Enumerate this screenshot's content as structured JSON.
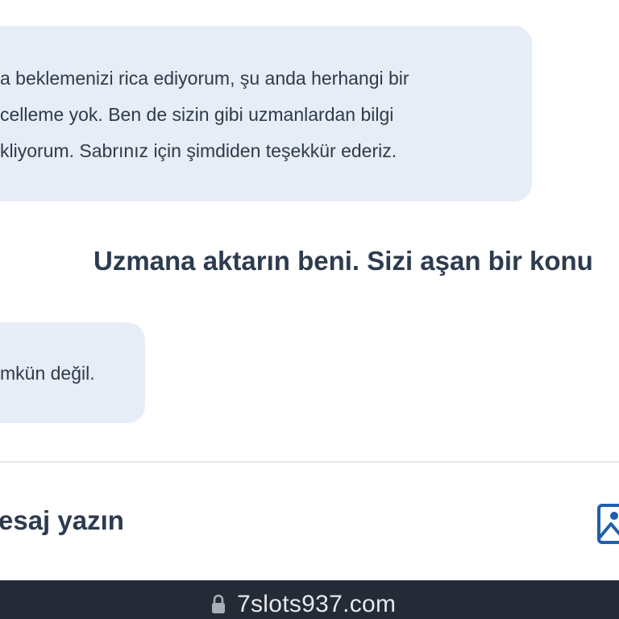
{
  "chat": {
    "agent_message_1": {
      "lines": [
        "a beklemenizi rica ediyorum, şu anda herhangi bir",
        "celleme yok. Ben de sizin gibi uzmanlardan bilgi",
        "kliyorum. Sabrınız için şimdiden teşekkür ederiz."
      ]
    },
    "user_message": "Uzmana aktarın beni. Sizi aşan bir konu",
    "agent_message_2": {
      "lines": [
        "mkün değil."
      ]
    }
  },
  "composer": {
    "placeholder": "esaj yazın",
    "attach_icon": "image-icon"
  },
  "browser": {
    "url": "7slots937.com",
    "lock_icon": "lock-icon",
    "bar_color": "#242b36"
  },
  "colors": {
    "agent_bubble": "#e6edf6",
    "text": "#2d3b4f",
    "accent": "#1f5fae"
  }
}
